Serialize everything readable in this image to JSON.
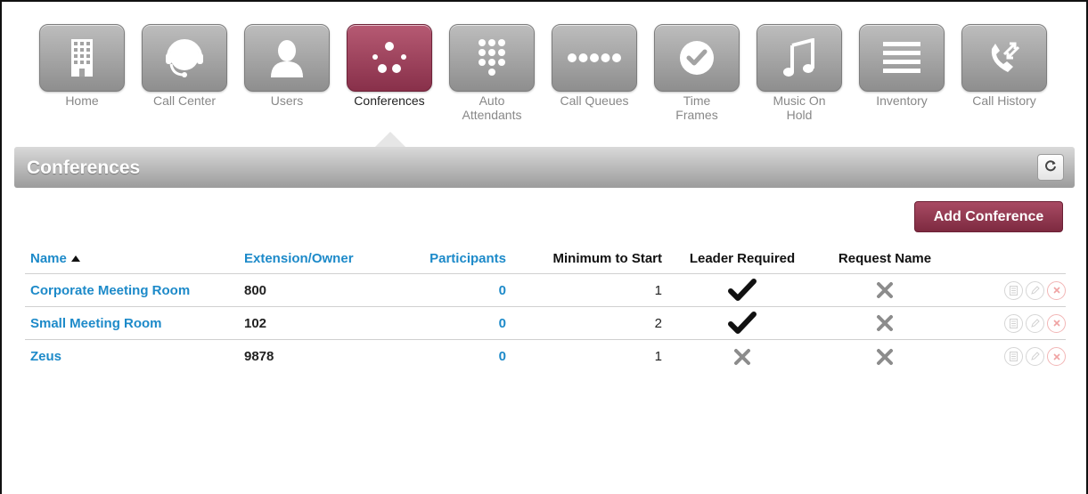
{
  "nav": {
    "items": [
      {
        "label": "Home",
        "icon": "building-icon",
        "active": false
      },
      {
        "label": "Call Center",
        "icon": "headset-icon",
        "active": false
      },
      {
        "label": "Users",
        "icon": "user-icon",
        "active": false
      },
      {
        "label": "Conferences",
        "icon": "conference-dots-icon",
        "active": true
      },
      {
        "label": "Auto\nAttendants",
        "icon": "keypad-icon",
        "active": false
      },
      {
        "label": "Call Queues",
        "icon": "queue-dots-icon",
        "active": false
      },
      {
        "label": "Time\nFrames",
        "icon": "clock-check-icon",
        "active": false
      },
      {
        "label": "Music On\nHold",
        "icon": "music-note-icon",
        "active": false
      },
      {
        "label": "Inventory",
        "icon": "list-icon",
        "active": false
      },
      {
        "label": "Call History",
        "icon": "phone-arrows-icon",
        "active": false
      }
    ]
  },
  "page": {
    "title": "Conferences",
    "add_button": "Add Conference"
  },
  "table": {
    "headers": {
      "name": "Name",
      "extension": "Extension/Owner",
      "participants": "Participants",
      "minimum": "Minimum to Start",
      "leader": "Leader Required",
      "request_name": "Request Name"
    },
    "rows": [
      {
        "name": "Corporate Meeting Room",
        "extension": "800",
        "participants": "0",
        "minimum": "1",
        "leader_required": true,
        "request_name": false
      },
      {
        "name": "Small Meeting Room",
        "extension": "102",
        "participants": "0",
        "minimum": "2",
        "leader_required": true,
        "request_name": false
      },
      {
        "name": "Zeus",
        "extension": "9878",
        "participants": "0",
        "minimum": "1",
        "leader_required": false,
        "request_name": false
      }
    ]
  },
  "colors": {
    "accent": "#88304a",
    "link": "#1d8ac9",
    "title_bar": "#a8a8a8"
  }
}
